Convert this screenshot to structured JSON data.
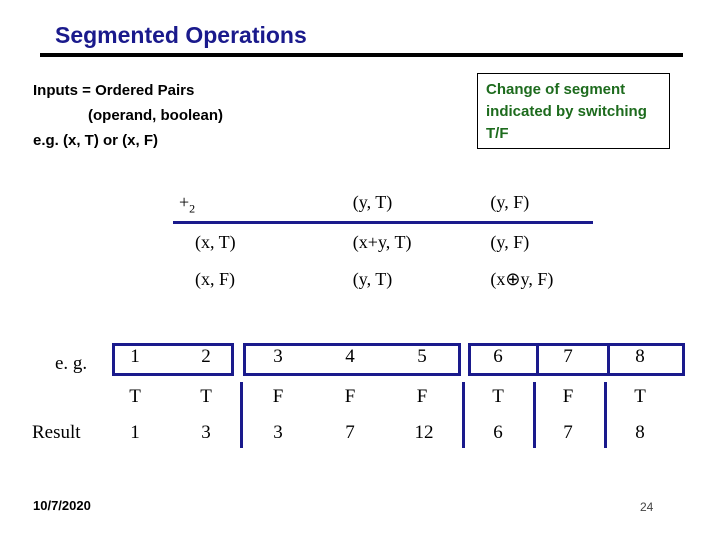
{
  "slide": {
    "title": "Segmented Operations",
    "footer_date": "10/7/2020",
    "page_number": "24",
    "accent_navy": "#1a1a8c",
    "accent_green": "#1d6b1d",
    "rule_black": "#000000"
  },
  "inputs_block": {
    "line1": "Inputs = Ordered Pairs",
    "line2": "(operand, boolean)",
    "line3": "e.g. (x, T) or (x, F)"
  },
  "callout": {
    "text": "Change of segment indicated by switching T/F"
  },
  "op_table": {
    "corner_symbol": "+",
    "corner_subscript": "2",
    "col_headers": [
      "(y, T)",
      "(y, F)"
    ],
    "rows": [
      {
        "label": "(x, T)",
        "cells": [
          "(x+y, T)",
          "(y, F)"
        ]
      },
      {
        "label": "(x, F)",
        "cells": [
          "(y, T)",
          "(x⊕y, F)"
        ]
      }
    ]
  },
  "example": {
    "eg_label": "e. g.",
    "result_label": "Result",
    "indices": [
      "1",
      "2",
      "3",
      "4",
      "5",
      "6",
      "7",
      "8"
    ],
    "booleans": [
      "T",
      "T",
      "F",
      "F",
      "F",
      "T",
      "F",
      "T"
    ],
    "results": [
      "1",
      "3",
      "3",
      "7",
      "12",
      "6",
      "7",
      "8"
    ],
    "segments": [
      {
        "members": [
          "1",
          "2"
        ]
      },
      {
        "members": [
          "3",
          "4",
          "5"
        ]
      },
      {
        "members": [
          "6"
        ]
      },
      {
        "members": [
          "7"
        ]
      },
      {
        "members": [
          "8"
        ]
      }
    ]
  }
}
